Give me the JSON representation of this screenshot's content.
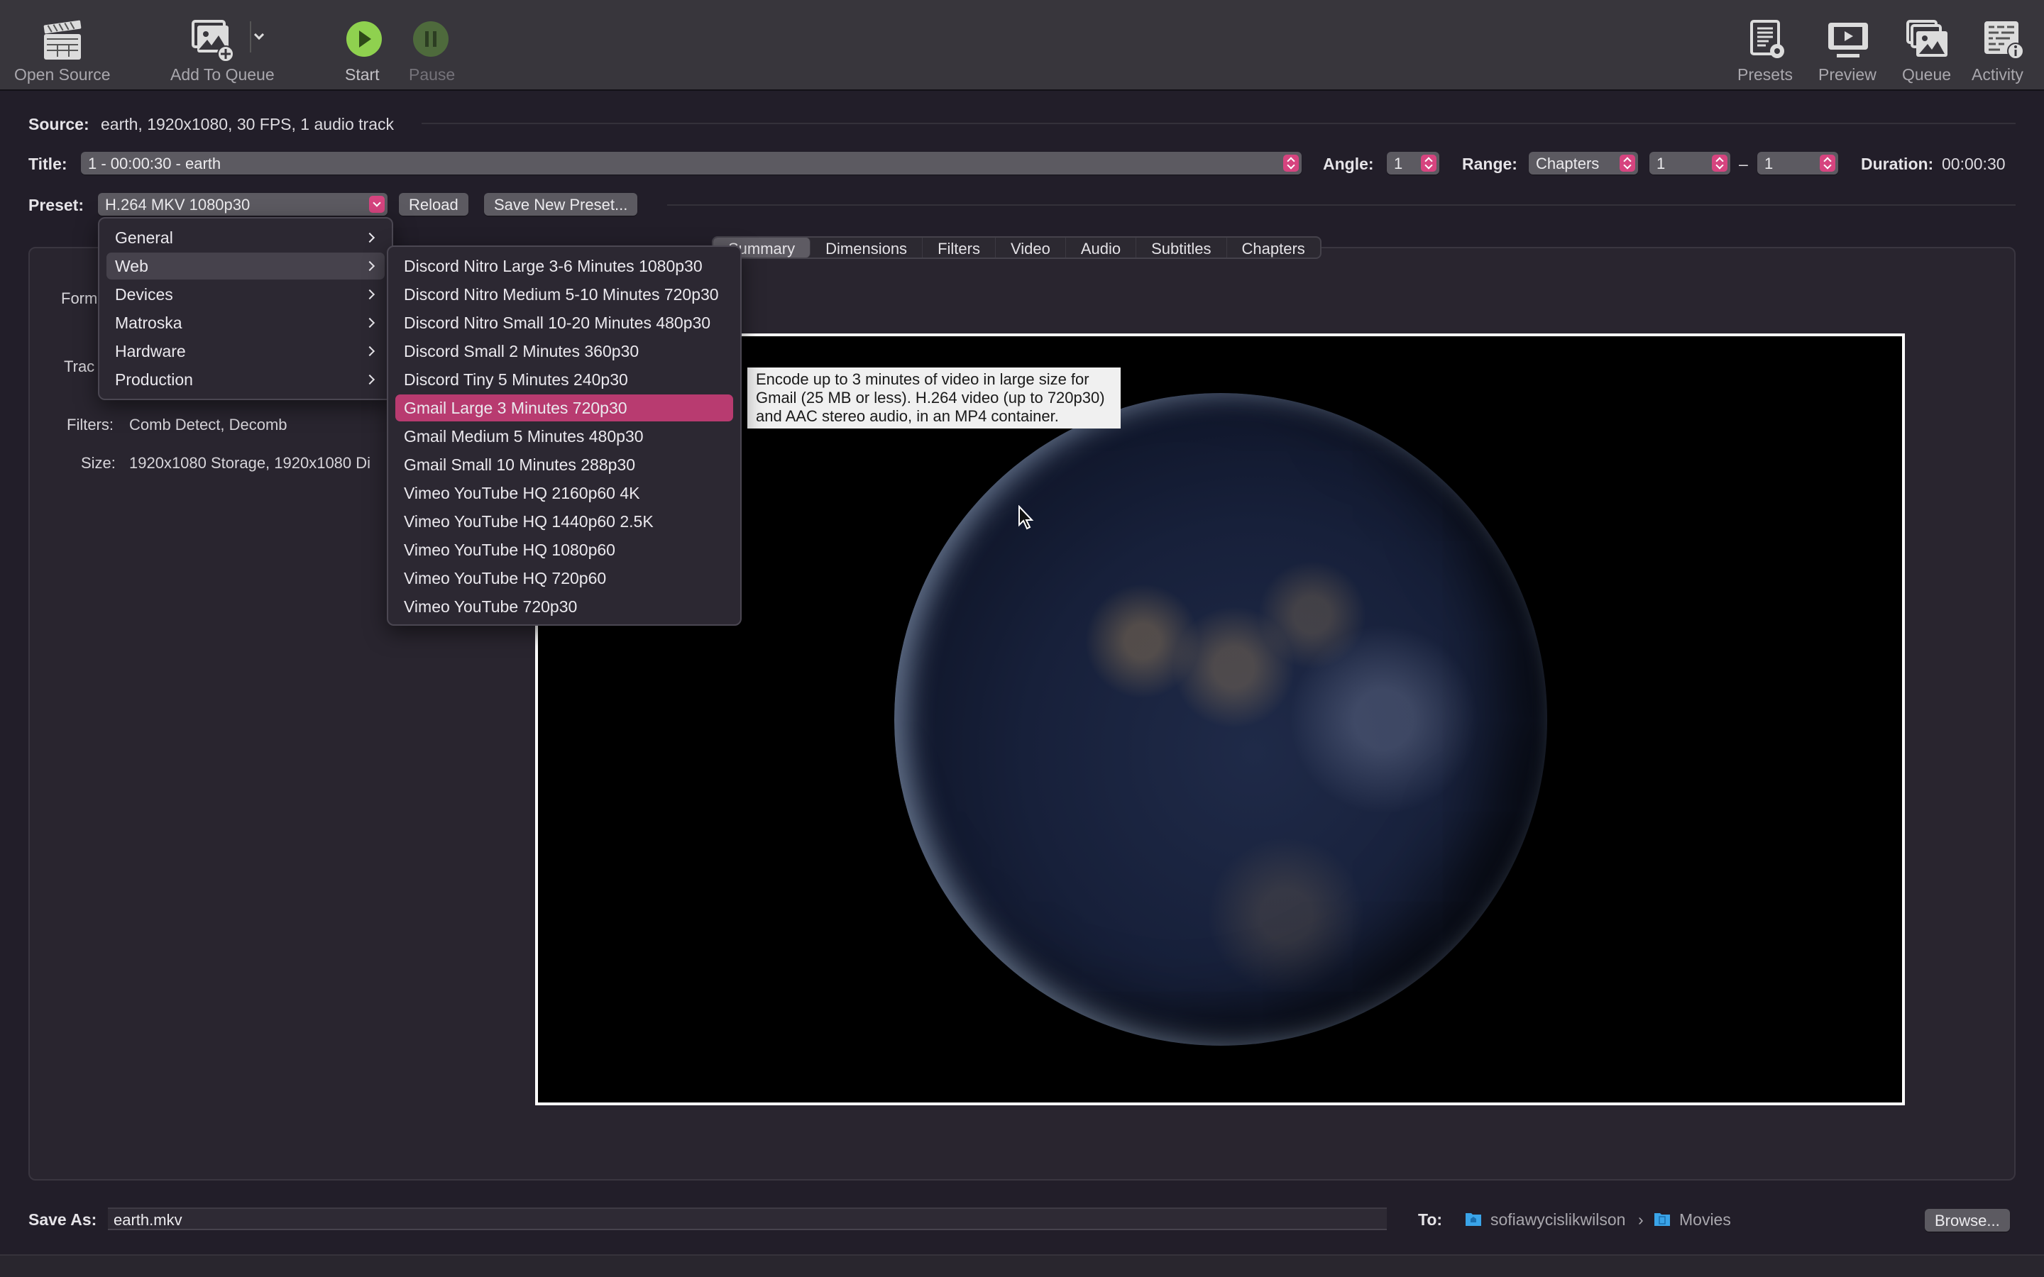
{
  "toolbar": {
    "open_source": "Open Source",
    "add_to_queue": "Add To Queue",
    "start": "Start",
    "pause": "Pause",
    "presets": "Presets",
    "preview": "Preview",
    "queue": "Queue",
    "activity": "Activity"
  },
  "source": {
    "label": "Source:",
    "value": "earth, 1920x1080, 30 FPS, 1 audio track"
  },
  "title_row": {
    "label": "Title:",
    "value": "1 - 00:00:30 - earth",
    "angle_label": "Angle:",
    "angle_value": "1",
    "range_label": "Range:",
    "range_type": "Chapters",
    "range_start": "1",
    "range_sep": "–",
    "range_end": "1",
    "duration_label": "Duration:",
    "duration_value": "00:00:30"
  },
  "preset_row": {
    "label": "Preset:",
    "value": "H.264 MKV 1080p30",
    "reload": "Reload",
    "save_new": "Save New Preset..."
  },
  "tabs": [
    {
      "label": "Summary",
      "active": true
    },
    {
      "label": "Dimensions",
      "active": false
    },
    {
      "label": "Filters",
      "active": false
    },
    {
      "label": "Video",
      "active": false
    },
    {
      "label": "Audio",
      "active": false
    },
    {
      "label": "Subtitles",
      "active": false
    },
    {
      "label": "Chapters",
      "active": false
    }
  ],
  "summary": {
    "format_label": "Form",
    "tracks_label": "Trac",
    "filters_label": "Filters:",
    "filters_value": "Comb Detect, Decomb",
    "size_label": "Size:",
    "size_value": "1920x1080 Storage, 1920x1080 Di"
  },
  "preset_menu": {
    "categories": [
      {
        "label": "General",
        "state": "normal"
      },
      {
        "label": "Web",
        "state": "hover"
      },
      {
        "label": "Devices",
        "state": "normal"
      },
      {
        "label": "Matroska",
        "state": "normal"
      },
      {
        "label": "Hardware",
        "state": "normal"
      },
      {
        "label": "Production",
        "state": "normal"
      }
    ],
    "web_items": [
      {
        "label": "Discord Nitro Large 3-6 Minutes 1080p30",
        "selected": false
      },
      {
        "label": "Discord Nitro Medium 5-10 Minutes 720p30",
        "selected": false
      },
      {
        "label": "Discord Nitro Small 10-20 Minutes 480p30",
        "selected": false
      },
      {
        "label": "Discord Small 2 Minutes 360p30",
        "selected": false
      },
      {
        "label": "Discord Tiny 5 Minutes 240p30",
        "selected": false
      },
      {
        "label": "Gmail Large 3 Minutes 720p30",
        "selected": true
      },
      {
        "label": "Gmail Medium 5 Minutes 480p30",
        "selected": false
      },
      {
        "label": "Gmail Small 10 Minutes 288p30",
        "selected": false
      },
      {
        "label": "Vimeo YouTube HQ 2160p60 4K",
        "selected": false
      },
      {
        "label": "Vimeo YouTube HQ 1440p60 2.5K",
        "selected": false
      },
      {
        "label": "Vimeo YouTube HQ 1080p60",
        "selected": false
      },
      {
        "label": "Vimeo YouTube HQ 720p60",
        "selected": false
      },
      {
        "label": "Vimeo YouTube 720p30",
        "selected": false
      }
    ]
  },
  "tooltip": {
    "text": "Encode up to 3 minutes of video in large size for Gmail (25 MB or less). H.264 video (up to 720p30) and AAC stereo audio, in an MP4 container."
  },
  "save": {
    "label": "Save As:",
    "value": "earth.mkv",
    "to_label": "To:",
    "path": [
      "sofiawycislikwilson",
      "Movies"
    ],
    "path_sep": "›",
    "browse": "Browse..."
  },
  "colors": {
    "accent": "#d6447f",
    "selected_item": "#b83b70",
    "start_green": "#8fd14f",
    "folder_blue": "#3aa4e8"
  }
}
